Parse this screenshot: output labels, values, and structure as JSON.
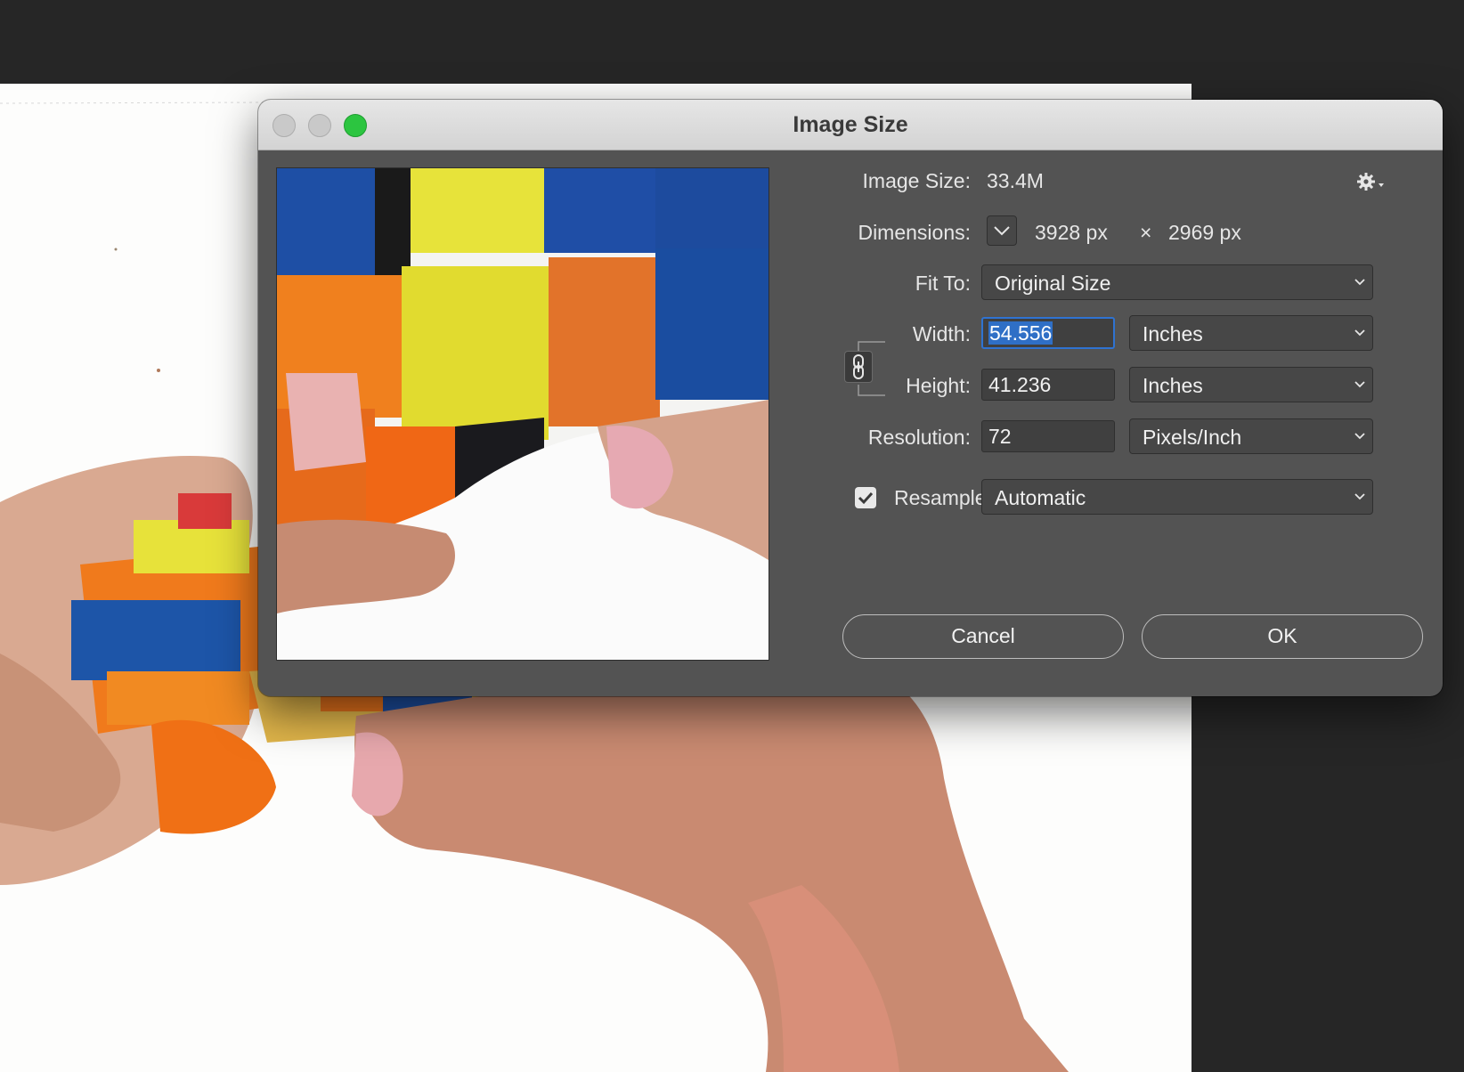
{
  "dialog": {
    "title": "Image Size",
    "image_size_label": "Image Size:",
    "image_size_value": "33.4M",
    "dimensions_label": "Dimensions:",
    "dimensions_width": "3928 px",
    "dimensions_times": "×",
    "dimensions_height": "2969 px",
    "fit_to_label": "Fit To:",
    "fit_to_value": "Original Size",
    "width_label": "Width:",
    "width_value": "54.556",
    "width_unit": "Inches",
    "height_label": "Height:",
    "height_value": "41.236",
    "height_unit": "Inches",
    "resolution_label": "Resolution:",
    "resolution_value": "72",
    "resolution_unit": "Pixels/Inch",
    "resample_label": "Resample:",
    "resample_checked": true,
    "resample_value": "Automatic",
    "cancel_label": "Cancel",
    "ok_label": "OK"
  },
  "icons": {
    "gear": "gear-icon",
    "link": "chain-link-icon",
    "dimensions_dropdown": "chevron-down-icon",
    "checkbox": "checkmark-icon"
  },
  "colors": {
    "dialog_bg": "#535353",
    "titlebar_bg": "#d9d9d9",
    "zoom_button": "#2cc540",
    "focus_ring": "#2f73d1",
    "selection": "#2f6fc6"
  }
}
